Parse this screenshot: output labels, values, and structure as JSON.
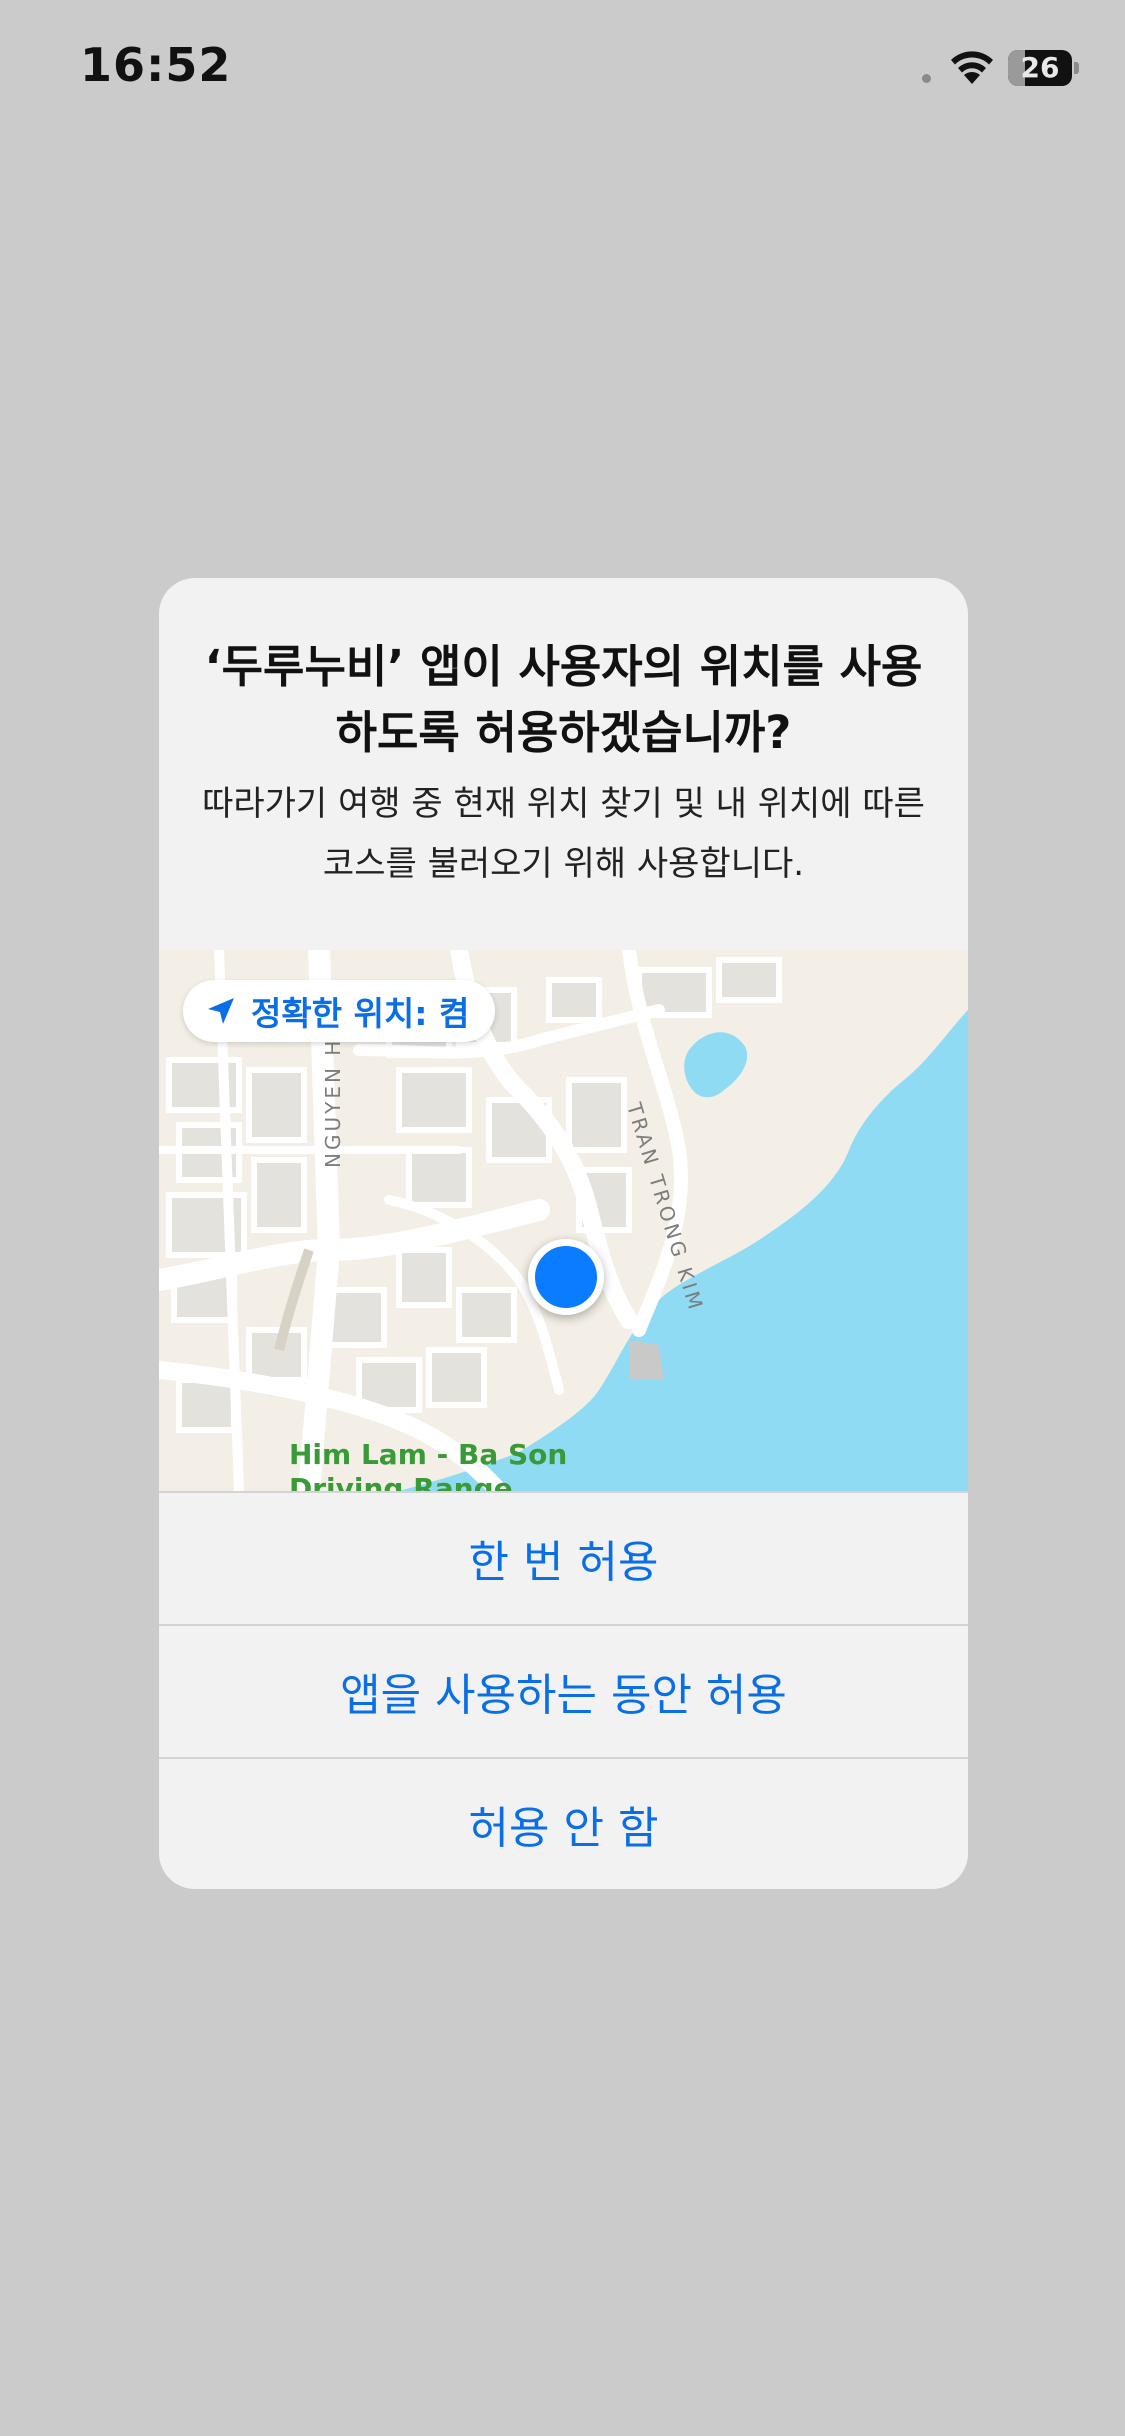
{
  "status_bar": {
    "time": "16:52",
    "battery_level": "26",
    "battery_percent": 26
  },
  "alert": {
    "title": "‘두루누비’ 앱이 사용자의 위치를 사용하도록 허용하겠습니까?",
    "message": "따라가기 여행 중 현재 위치 찾기 및 내 위치에 따른 코스를 불러오기 위해 사용합니다.",
    "map": {
      "precise_location_label": "정확한 위치: 켬",
      "street_labels": [
        "NGUYEN H",
        "TRAN TRONG KIM"
      ],
      "poi_label_line1": "Him Lam - Ba Son",
      "poi_label_line2": "Driving Range",
      "colors": {
        "land": "#f3efe6",
        "water": "#8fdbf4",
        "road": "#ffffff",
        "block": "#e4e2dd",
        "location_dot": "#0a7cff",
        "poi_text": "#3a9a37"
      }
    },
    "buttons": {
      "allow_once": "한 번 허용",
      "allow_while_using": "앱을 사용하는 동안 허용",
      "dont_allow": "허용 안 함"
    },
    "accent_color": "#0a6ee6"
  }
}
